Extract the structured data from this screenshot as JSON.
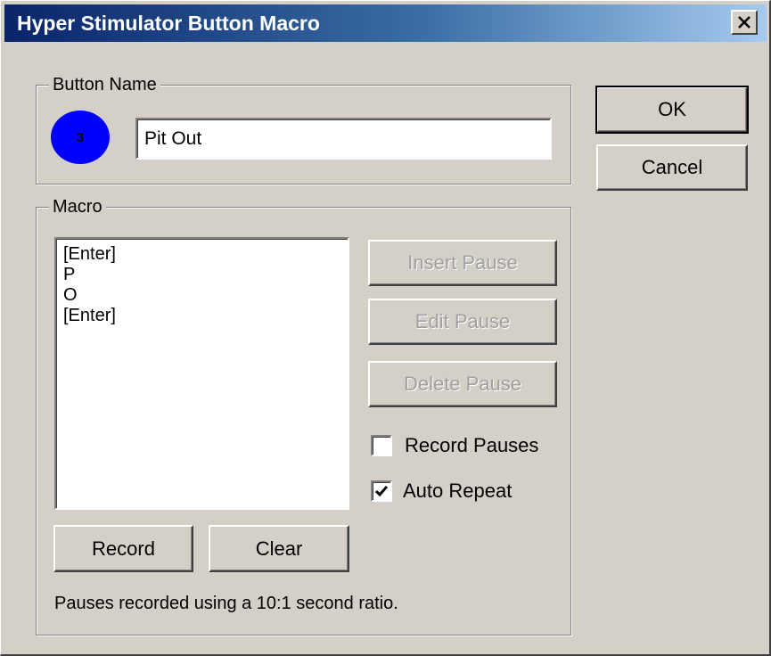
{
  "window": {
    "title": "Hyper Stimulator Button Macro"
  },
  "button_name": {
    "group_label": "Button Name",
    "badge_number": "3",
    "badge_color": "#0000ff",
    "name_value": "Pit Out"
  },
  "dialog_buttons": {
    "ok": "OK",
    "cancel": "Cancel"
  },
  "macro": {
    "group_label": "Macro",
    "items": [
      "[Enter]",
      "P",
      "O",
      "[Enter]"
    ],
    "insert_pause": "Insert Pause",
    "edit_pause": "Edit Pause",
    "delete_pause": "Delete Pause",
    "record_pauses": {
      "label": "Record Pauses",
      "checked": false
    },
    "auto_repeat": {
      "label": "Auto Repeat",
      "checked": true
    },
    "record": "Record",
    "clear": "Clear",
    "note": "Pauses recorded using a 10:1 second ratio."
  },
  "colors": {
    "title_gradient_start": "#0a246a",
    "title_gradient_end": "#a6caf0",
    "face": "#d4d0c8"
  }
}
